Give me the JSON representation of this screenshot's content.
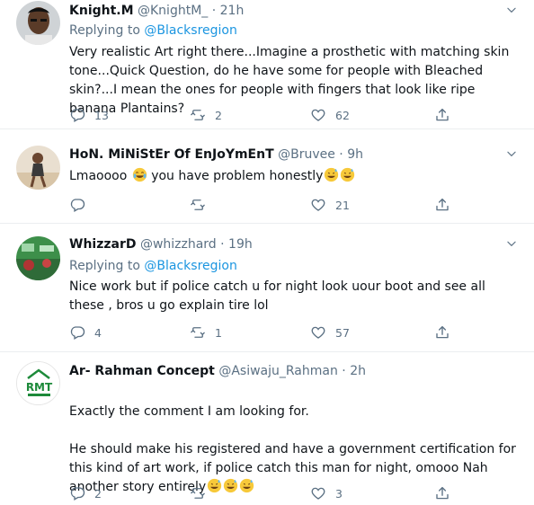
{
  "tweets": [
    {
      "name": "Knight.M",
      "handle": "@KnightM_",
      "time": "· 21h",
      "replying_label": "Replying to",
      "replying_handle": "@Blacksregion",
      "text": "Very realistic Art right there...Imagine a prosthetic with matching skin tone...Quick Question, do he have some for people with Bleached skin?...I mean the ones for people with fingers that look like ripe banana Plantains?",
      "reply_count": "13",
      "retweet_count": "2",
      "like_count": "62"
    },
    {
      "name": "HoN. MiNiStEr Of EnJoYmEnT",
      "handle": "@Bruvee",
      "time": "· 9h",
      "text": "Lmaoooo",
      "text2": "you have problem honestly",
      "reply_count": "",
      "retweet_count": "",
      "like_count": "21"
    },
    {
      "name": "WhizzarD",
      "handle": "@whizzhard",
      "time": "· 19h",
      "replying_label": "Replying to",
      "replying_handle": "@Blacksregion",
      "text": "Nice work but if police catch u for night look uour boot and see all these , bros u go explain tire lol",
      "reply_count": "4",
      "retweet_count": "1",
      "like_count": "57"
    },
    {
      "name": "Ar- Rahman Concept",
      "handle": "@Asiwaju_Rahman",
      "time": "· 2h",
      "text": "Exactly the comment I am looking for.\n\nHe should make his registered and have a government certification for this kind of art work, if police catch this man for night, omooo Nah another story entirely",
      "reply_count": "2",
      "retweet_count": "",
      "like_count": "3",
      "avatar_text": "RMT"
    }
  ],
  "colors": {
    "accent": "#1b95e0",
    "muted": "#5b7083",
    "text": "#0f1419",
    "divider": "#ebeef0"
  }
}
